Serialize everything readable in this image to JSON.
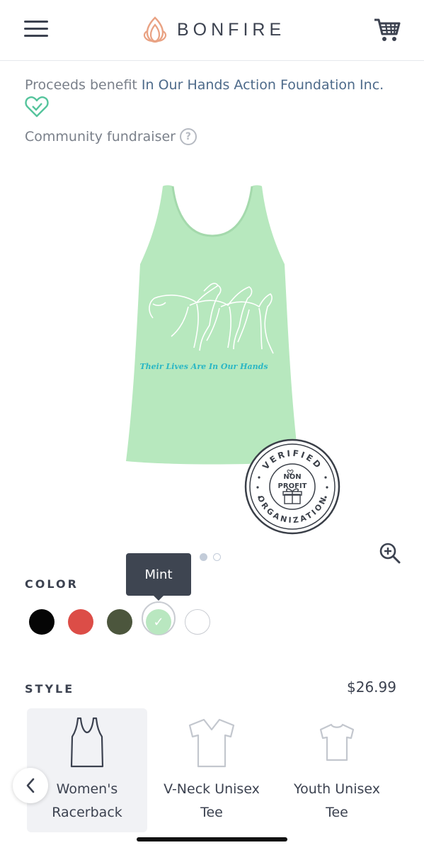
{
  "header": {
    "brand": "BONFIRE",
    "icons": [
      "menu-icon",
      "flame-logo-icon",
      "cart-icon"
    ]
  },
  "campaign": {
    "proceeds_prefix": "Proceeds benefit ",
    "organization": "In Our Hands Action Foundation Inc.",
    "type_label": "Community fundraiser",
    "help_symbol": "?"
  },
  "product": {
    "print_text": "Their Lives Are In Our Hands",
    "badge_lines": [
      "VERIFIED",
      "NON",
      "PROFIT",
      "ORGANIZATION"
    ],
    "image_count": 2,
    "active_image": 1,
    "colors": {
      "mint": "#b7e8be",
      "print": "#2bb7c4"
    }
  },
  "color_picker": {
    "label": "COLOR",
    "tooltip": "Mint",
    "selected_check": "✓",
    "swatches": [
      {
        "name": "black",
        "color": "#050505"
      },
      {
        "name": "red",
        "color": "#dc4d47"
      },
      {
        "name": "olive",
        "color": "#4c563d"
      },
      {
        "name": "mint",
        "color": "#b9e7c0"
      },
      {
        "name": "white",
        "color": "#ffffff"
      }
    ]
  },
  "style_picker": {
    "label": "STYLE",
    "price": "$26.99",
    "options": [
      {
        "line1": "Women's",
        "line2": "Racerback"
      },
      {
        "line1": "V-Neck Unisex",
        "line2": "Tee"
      },
      {
        "line1": "Youth Unisex",
        "line2": "Tee"
      }
    ]
  }
}
